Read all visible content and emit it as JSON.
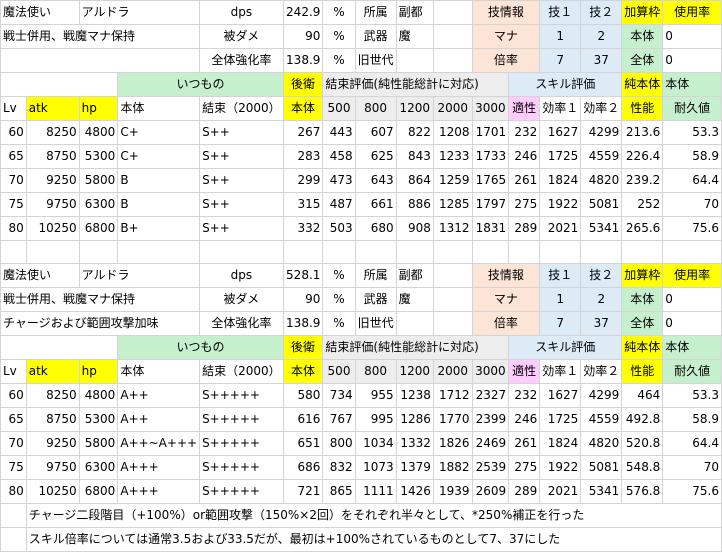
{
  "block1": {
    "row1": [
      "魔法使い",
      "アルドラ",
      "",
      "dps",
      "242.9",
      "%",
      "所属",
      "副都",
      "",
      "技情報",
      "",
      "技１",
      "技２",
      "加算枠",
      "使用率"
    ],
    "row2": [
      "戦士併用、戦魔マナ保持",
      "",
      "",
      "被ダメ",
      "90",
      "%",
      "武器",
      "魔",
      "",
      "マナ",
      "",
      "1",
      "2",
      "本体",
      "0"
    ],
    "row3": [
      "",
      "",
      "",
      "全体強化率",
      "138.9",
      "%",
      "旧世代",
      "",
      "",
      "倍率",
      "",
      "7",
      "37",
      "全体",
      "0"
    ],
    "section": [
      "",
      "",
      "",
      "いつもの",
      "",
      "後衛",
      "結束評価(純性能総計に対応)",
      "",
      "",
      "",
      "",
      "スキル評価",
      "",
      "",
      "純本体",
      "本体"
    ],
    "header": [
      "Lv",
      "atk",
      "hp",
      "本体",
      "結束（2000）",
      "本体",
      "500",
      "800",
      "1200",
      "2000",
      "3000",
      "適性",
      "効率１",
      "効率２",
      "性能",
      "耐久値"
    ],
    "rows": [
      [
        "60",
        "8250",
        "4800",
        "C+",
        "S++",
        "267",
        "443",
        "607",
        "822",
        "1208",
        "1701",
        "232",
        "1627",
        "4299",
        "213.6",
        "53.3"
      ],
      [
        "65",
        "8750",
        "5300",
        "C+",
        "S++",
        "283",
        "458",
        "625",
        "843",
        "1233",
        "1733",
        "246",
        "1725",
        "4559",
        "226.4",
        "58.9"
      ],
      [
        "70",
        "9250",
        "5800",
        "B",
        "S++",
        "299",
        "473",
        "643",
        "864",
        "1259",
        "1765",
        "261",
        "1824",
        "4820",
        "239.2",
        "64.4"
      ],
      [
        "75",
        "9750",
        "6300",
        "B",
        "S++",
        "315",
        "487",
        "661",
        "886",
        "1285",
        "1797",
        "275",
        "1922",
        "5081",
        "252",
        "70"
      ],
      [
        "80",
        "10250",
        "6800",
        "B+",
        "S++",
        "332",
        "503",
        "680",
        "908",
        "1312",
        "1831",
        "289",
        "2021",
        "5341",
        "265.6",
        "75.6"
      ]
    ]
  },
  "block2": {
    "row1": [
      "魔法使い",
      "アルドラ",
      "",
      "dps",
      "528.1",
      "%",
      "所属",
      "副都",
      "",
      "技情報",
      "",
      "技１",
      "技２",
      "加算枠",
      "使用率"
    ],
    "row2": [
      "戦士併用、戦魔マナ保持",
      "",
      "",
      "被ダメ",
      "90",
      "%",
      "武器",
      "魔",
      "",
      "マナ",
      "",
      "1",
      "2",
      "本体",
      "0"
    ],
    "row3": [
      "チャージおよび範囲攻撃加味",
      "",
      "",
      "全体強化率",
      "138.9",
      "%",
      "旧世代",
      "",
      "",
      "倍率",
      "",
      "7",
      "37",
      "全体",
      "0"
    ],
    "section": [
      "",
      "",
      "",
      "いつもの",
      "",
      "後衛",
      "結束評価(純性能総計に対応)",
      "",
      "",
      "",
      "",
      "スキル評価",
      "",
      "",
      "純本体",
      "本体"
    ],
    "header": [
      "Lv",
      "atk",
      "hp",
      "本体",
      "結束（2000）",
      "本体",
      "500",
      "800",
      "1200",
      "2000",
      "3000",
      "適性",
      "効率１",
      "効率２",
      "性能",
      "耐久値"
    ],
    "rows": [
      [
        "60",
        "8250",
        "4800",
        "A++",
        "S+++++",
        "580",
        "734",
        "955",
        "1238",
        "1712",
        "2327",
        "232",
        "1627",
        "4299",
        "464",
        "53.3"
      ],
      [
        "65",
        "8750",
        "5300",
        "A++",
        "S+++++",
        "616",
        "767",
        "995",
        "1286",
        "1770",
        "2399",
        "246",
        "1725",
        "4559",
        "492.8",
        "58.9"
      ],
      [
        "70",
        "9250",
        "5800",
        "A++~A+++",
        "S+++++",
        "651",
        "800",
        "1034",
        "1332",
        "1826",
        "2469",
        "261",
        "1824",
        "4820",
        "520.8",
        "64.4"
      ],
      [
        "75",
        "9750",
        "6300",
        "A+++",
        "S+++++",
        "686",
        "832",
        "1073",
        "1379",
        "1882",
        "2539",
        "275",
        "1922",
        "5081",
        "548.8",
        "70"
      ],
      [
        "80",
        "10250",
        "6800",
        "A+++",
        "S+++++",
        "721",
        "865",
        "1111",
        "1426",
        "1939",
        "2609",
        "289",
        "2021",
        "5341",
        "576.8",
        "75.6"
      ]
    ]
  },
  "notes": [
    "チャージ二段階目（+100%）or範囲攻撃（150%×2回）をそれぞれ半々として、*250%補正を行った",
    "スキル倍率については通常3.5および33.5だが、最初は+100%されているものとして7、37にした"
  ],
  "colors": {
    "pink": "#fce4d6",
    "blue": "#ddebf7",
    "yellow": "#ffff00",
    "lightgreen": "#c6efce",
    "gray": "#ededed",
    "magenta": "#ffccff",
    "green": "#a9d08e"
  }
}
